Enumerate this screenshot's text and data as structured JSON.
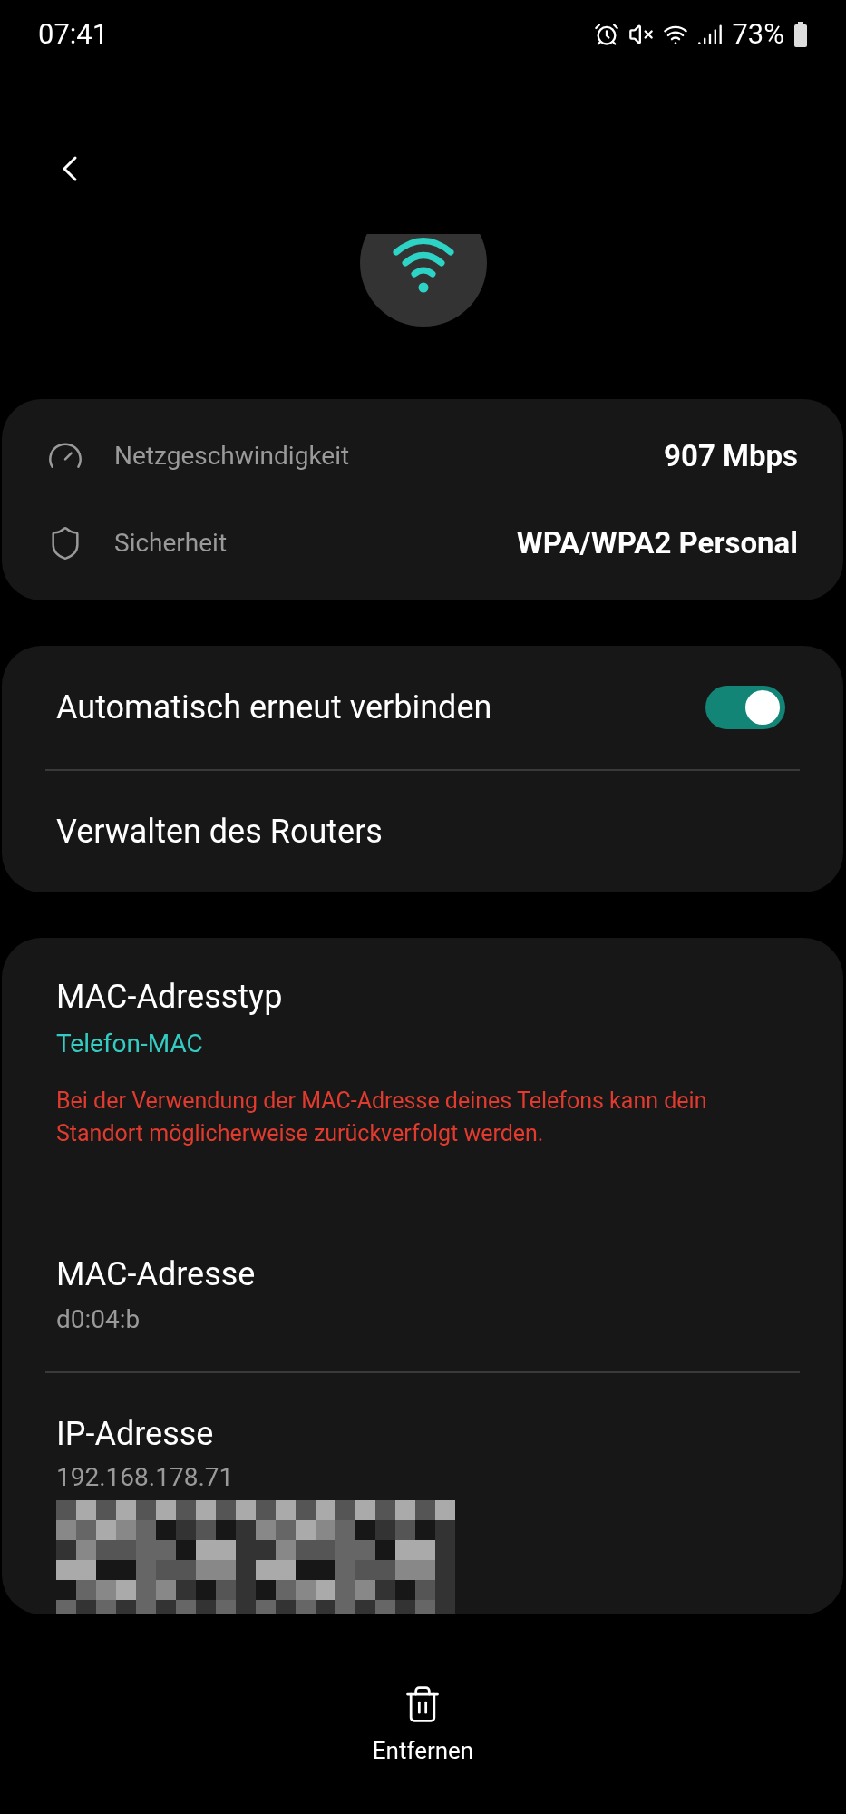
{
  "status_bar": {
    "time": "07:41",
    "battery": "73%"
  },
  "network_info": [
    {
      "kind": "speed",
      "label": "Netzgeschwindigkeit",
      "value": "907 Mbps"
    },
    {
      "kind": "security",
      "label": "Sicherheit",
      "value": "WPA/WPA2 Personal"
    }
  ],
  "settings": [
    {
      "kind": "toggle",
      "label": "Automatisch erneut verbinden",
      "on": true
    },
    {
      "kind": "link",
      "label": "Verwalten des Routers"
    }
  ],
  "mac_type": {
    "label": "MAC-Adresstyp",
    "value": "Telefon-MAC",
    "warning": "Bei der Verwendung der MAC-Adresse deines Telefons kann dein Standort möglicherweise zurückverfolgt werden."
  },
  "mac_address": {
    "label": "MAC-Adresse",
    "value": "d0:04:b"
  },
  "ip_address": {
    "label": "IP-Adresse",
    "value": "192.168.178.71"
  },
  "bottom_action": {
    "label": "Entfernen"
  }
}
